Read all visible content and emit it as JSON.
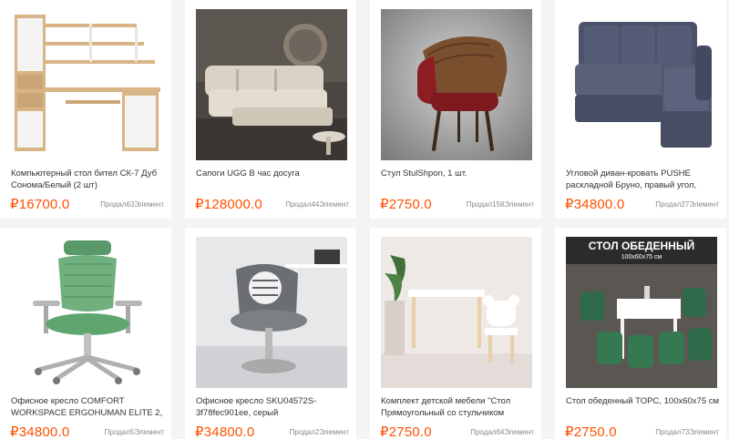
{
  "currency_symbol": "₽",
  "products": [
    {
      "title": "Компьютерный стол бител СК-7 Дуб Сонома/Белый  (2 шт)",
      "price": "16700.0",
      "sold": "Продал63Элемент"
    },
    {
      "title": "Сапоги UGG В час досуга",
      "price": "128000.0",
      "sold": "Продал44Элемент"
    },
    {
      "title": "Стул StulShpon, 1 шт.",
      "price": "2750.0",
      "sold": "Продал158Элемент"
    },
    {
      "title": "Угловой диван-кровать PUSHE раскладной Бруно, правый угол,",
      "price": "34800.0",
      "sold": "Продал27Элемент"
    },
    {
      "title": "Офисное кресло COMFORT WORKSPACE ERGOHUMAN ELITE 2,",
      "price": "34800.0",
      "sold": "Продал5Элемент"
    },
    {
      "title": "Офисное кресло SKU04572S-3f78fec901ee, серый",
      "price": "34800.0",
      "sold": "Продал2Элемент"
    },
    {
      "title": "Комплект детской мебели \"Стол Прямоугольный со стульчиком",
      "price": "2750.0",
      "sold": "Продал64Элемент"
    },
    {
      "title": "Стол обеденный TOPC, 100x60x75 см",
      "price": "2750.0",
      "sold": "Продал73Элемент"
    }
  ],
  "banner": {
    "title": "СТОЛ ОБЕДЕННЫЙ",
    "size": "100x60x75 см"
  },
  "colors": {
    "price": "#ff5000",
    "card_bg": "#ffffff",
    "page_bg": "#f4f4f4"
  }
}
